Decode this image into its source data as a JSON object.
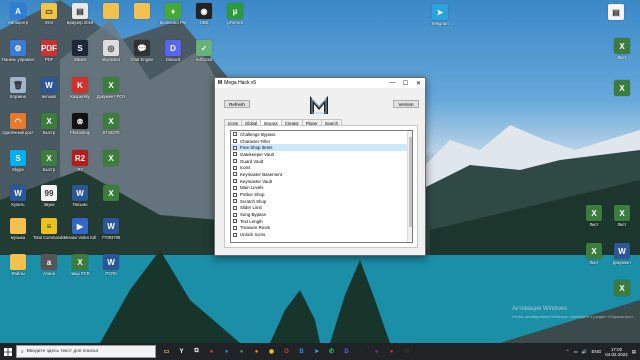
{
  "desktop_left": [
    {
      "label": "Автоцентр",
      "name": "desktop-icon-autocenter",
      "color": "#2d7fd6",
      "glyph": "А"
    },
    {
      "label": "Этот",
      "name": "desktop-icon-this-pc",
      "color": "#f4c542",
      "glyph": "▭"
    },
    {
      "label": "Браузер 2019",
      "name": "desktop-icon-browser-2019",
      "color": "#e8e8e8",
      "glyph": "▤"
    },
    {
      "label": "",
      "name": "desktop-icon-folder-1",
      "color": "#f2c14e",
      "glyph": ""
    },
    {
      "label": "",
      "name": "desktop-icon-folder-2",
      "color": "#f2c14e",
      "glyph": ""
    },
    {
      "label": "Scorecard Pro",
      "name": "desktop-icon-scorecard",
      "color": "#4a3",
      "glyph": "♦"
    },
    {
      "label": "OBS",
      "name": "desktop-icon-obs",
      "color": "#222",
      "glyph": "◉"
    },
    {
      "label": "µTorrent",
      "name": "desktop-icon-utorrent",
      "color": "#2a9d3a",
      "glyph": "µ"
    },
    {
      "label": "Панель управления",
      "name": "desktop-icon-control-panel",
      "color": "#3a7bd5",
      "glyph": "⚙"
    },
    {
      "label": "PDF",
      "name": "desktop-icon-pdf",
      "color": "#d32f2f",
      "glyph": "PDF"
    },
    {
      "label": "Steam",
      "name": "desktop-icon-steam",
      "color": "#1b2838",
      "glyph": "S"
    },
    {
      "label": "skyrocket",
      "name": "desktop-icon-skyrocket",
      "color": "#ddd",
      "glyph": "◎"
    },
    {
      "label": "Chat Engine",
      "name": "desktop-icon-chat",
      "color": "#333",
      "glyph": "💬"
    },
    {
      "label": "Discord",
      "name": "desktop-icon-discord",
      "color": "#5865f2",
      "glyph": "D"
    },
    {
      "label": "AdGuard",
      "name": "desktop-icon-adguard",
      "color": "#67b279",
      "glyph": "✓"
    },
    {
      "label": "Корзина",
      "name": "desktop-icon-recycle-bin",
      "color": "#9fb5c8",
      "glyph": "🗑"
    },
    {
      "label": "вельмо",
      "name": "desktop-icon-word-1",
      "color": "#2b5797",
      "glyph": "W"
    },
    {
      "label": "Kaspersky",
      "name": "desktop-icon-kaspersky",
      "color": "#d3322b",
      "glyph": "K"
    },
    {
      "label": "Документ PCR",
      "name": "desktop-icon-doc-pcr",
      "color": "#3c7d3e",
      "glyph": "X"
    },
    {
      "label": "Удалённый доступ",
      "name": "desktop-icon-remote",
      "color": "#e8782a",
      "glyph": "◠"
    },
    {
      "label": "Быстр",
      "name": "desktop-icon-fast",
      "color": "#3c7d3e",
      "glyph": "X"
    },
    {
      "label": "Photoshop",
      "name": "desktop-icon-app-x",
      "color": "#111",
      "glyph": "⊗"
    },
    {
      "label": "ST18270",
      "name": "desktop-icon-st18270",
      "color": "#3c7d3e",
      "glyph": "X"
    },
    {
      "label": "Skype",
      "name": "desktop-icon-skype",
      "color": "#00aff0",
      "glyph": "S"
    },
    {
      "label": "Быстр",
      "name": "desktop-icon-fast-2",
      "color": "#3c7d3e",
      "glyph": "X"
    },
    {
      "label": "R2",
      "name": "desktop-icon-r2",
      "color": "#b71c1c",
      "glyph": "R2"
    },
    {
      "label": "",
      "name": "desktop-icon-excel-3",
      "color": "#3c7d3e",
      "glyph": "X"
    },
    {
      "label": "Купить",
      "name": "desktop-icon-buy",
      "color": "#2b5797",
      "glyph": "W"
    },
    {
      "label": "Звуки",
      "name": "desktop-icon-sounds",
      "color": "#f5f5f5",
      "glyph": "99"
    },
    {
      "label": "Письмо",
      "name": "desktop-icon-letter",
      "color": "#2b5797",
      "glyph": "W"
    },
    {
      "label": "",
      "name": "desktop-icon-excel-4",
      "color": "#3c7d3e",
      "glyph": "X"
    },
    {
      "label": "музыка",
      "name": "desktop-icon-music",
      "color": "#f2c14e",
      "glyph": ""
    },
    {
      "label": "Total Commander",
      "name": "desktop-icon-total-commander",
      "color": "#e9c21c",
      "glyph": "≡"
    },
    {
      "label": "Movavi Video Editor Plus",
      "name": "desktop-icon-movavi",
      "color": "#3466c9",
      "glyph": "▶"
    },
    {
      "label": "77093706",
      "name": "desktop-icon-num",
      "color": "#2b5797",
      "glyph": "W"
    },
    {
      "label": "Файлы",
      "name": "desktop-icon-files",
      "color": "#f2c14e",
      "glyph": ""
    },
    {
      "label": "Асана",
      "name": "desktop-icon-asana",
      "color": "#555",
      "glyph": "a"
    },
    {
      "label": "лица PCR",
      "name": "desktop-icon-lica",
      "color": "#3c7d3e",
      "glyph": "X"
    },
    {
      "label": "PCR0",
      "name": "desktop-icon-pcr0",
      "color": "#2b5797",
      "glyph": "W"
    }
  ],
  "desktop_right": [
    {
      "label": "Telegram",
      "name": "desktop-icon-telegram",
      "color": "#2aa3de",
      "glyph": "➤"
    },
    {
      "label": "",
      "name": "desktop-icon-r-1",
      "color": "#f5f5f5",
      "glyph": "▤"
    },
    {
      "label": "Лист",
      "name": "desktop-icon-r-2",
      "color": "#3c7d3e",
      "glyph": "X"
    },
    {
      "label": "",
      "name": "desktop-icon-r-3",
      "color": "#3c7d3e",
      "glyph": "X"
    },
    {
      "label": "Лист",
      "name": "desktop-icon-r-4",
      "color": "#3c7d3e",
      "glyph": "X"
    },
    {
      "label": "Лист",
      "name": "desktop-icon-r-5",
      "color": "#3c7d3e",
      "glyph": "X"
    },
    {
      "label": "Документ",
      "name": "desktop-icon-r-6",
      "color": "#2b5797",
      "glyph": "W"
    },
    {
      "label": "Лист",
      "name": "desktop-icon-r-7",
      "color": "#3c7d3e",
      "glyph": "X"
    },
    {
      "label": "",
      "name": "desktop-icon-r-8",
      "color": "#3c7d3e",
      "glyph": "X"
    }
  ],
  "window": {
    "title": "Mega Hack v5",
    "minimize": "—",
    "maximize": "☐",
    "close": "✕",
    "button_left": "Refresh",
    "button_right": "Version",
    "tabs": [
      "Icons",
      "Global",
      "Bypass",
      "Creator",
      "Player",
      "Search"
    ],
    "active_tab_index": 2,
    "items": [
      "Challenge Bypass",
      "Character Filter",
      "Free Shop Items",
      "Gatekeeper Vault",
      "Guard Vault",
      "Icons",
      "Keymaster Basement",
      "Keymaster Vault",
      "Main Levels",
      "Potbor Shop",
      "Scratch Shop",
      "Slider Limit",
      "Song Bypass",
      "Text Length",
      "Treasure Room",
      "Unlock Icons"
    ],
    "selected_index": 2
  },
  "taskbar": {
    "search_placeholder": "Введите здесь текст для поиска",
    "apps": [
      {
        "name": "taskbar-explorer-icon",
        "color": "#f2c14e",
        "glyph": "▭"
      },
      {
        "name": "taskbar-yandex-icon",
        "color": "#fff",
        "glyph": "Y"
      },
      {
        "name": "taskbar-taskview-icon",
        "color": "#ddd",
        "glyph": "⧉"
      },
      {
        "name": "taskbar-app-1-icon",
        "color": "#e53935",
        "glyph": "●"
      },
      {
        "name": "taskbar-app-2-icon",
        "color": "#1e88e5",
        "glyph": "●"
      },
      {
        "name": "taskbar-app-3-icon",
        "color": "#43a047",
        "glyph": "●"
      },
      {
        "name": "taskbar-app-4-icon",
        "color": "#fb8c00",
        "glyph": "●"
      },
      {
        "name": "taskbar-chrome-icon",
        "color": "#fbc02d",
        "glyph": "◉"
      },
      {
        "name": "taskbar-opera-icon",
        "color": "#e53935",
        "glyph": "O"
      },
      {
        "name": "taskbar-vk-icon",
        "color": "#2787f5",
        "glyph": "B"
      },
      {
        "name": "taskbar-telegram-icon",
        "color": "#2aa3de",
        "glyph": "➤"
      },
      {
        "name": "taskbar-whatsapp-icon",
        "color": "#25d366",
        "glyph": "✆"
      },
      {
        "name": "taskbar-discord-icon",
        "color": "#5865f2",
        "glyph": "D"
      },
      {
        "name": "taskbar-steam-icon",
        "color": "#1b2838",
        "glyph": "S"
      },
      {
        "name": "taskbar-app-5-icon",
        "color": "#8e24aa",
        "glyph": "●"
      },
      {
        "name": "taskbar-app-6-icon",
        "color": "#d32f2f",
        "glyph": "●"
      },
      {
        "name": "taskbar-megahack-icon",
        "color": "#333",
        "glyph": "M"
      }
    ],
    "lang": "ENG",
    "time": "17:02",
    "date": "04.02.2022"
  },
  "watermark": {
    "line1": "Активация Windows",
    "line2": "Чтобы активировать Windows, перейдите в раздел «Параметры»."
  }
}
